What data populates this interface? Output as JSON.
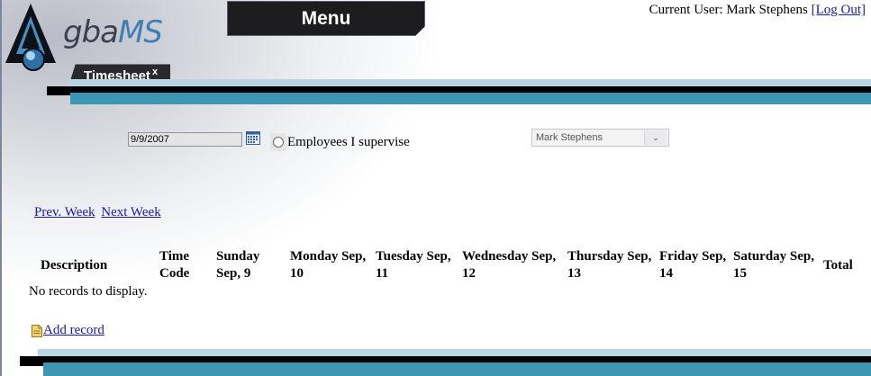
{
  "header": {
    "logo_text_a": "gba",
    "logo_text_b": "MS",
    "menu_label": "Menu",
    "user_prefix": "Current User: Mark Stephens",
    "logout_label": "[Log Out]"
  },
  "tab": {
    "label": "Timesheet",
    "close": "x"
  },
  "filters": {
    "date_value": "9/9/2007",
    "radio_label": "Employees I supervise",
    "employee_selected": "Mark Stephens"
  },
  "week_nav": {
    "prev": "Prev. Week",
    "next": "Next Week"
  },
  "grid": {
    "columns": [
      {
        "l1": "Description",
        "l2": ""
      },
      {
        "l1": "Time",
        "l2": "Code"
      },
      {
        "l1": "Sunday",
        "l2": "Sep, 9"
      },
      {
        "l1": "Monday Sep,",
        "l2": "10"
      },
      {
        "l1": "Tuesday Sep,",
        "l2": "11"
      },
      {
        "l1": "Wednesday Sep,",
        "l2": "12"
      },
      {
        "l1": "Thursday Sep,",
        "l2": "13"
      },
      {
        "l1": "Friday Sep,",
        "l2": "14"
      },
      {
        "l1": "Saturday Sep,",
        "l2": "15"
      },
      {
        "l1": "Total",
        "l2": ""
      }
    ],
    "empty_message": "No records to display."
  },
  "actions": {
    "add_record": "Add record"
  },
  "colors": {
    "teal": "#3d97b2",
    "light_band": "#b9d4e2",
    "link": "#1a1aa6"
  }
}
